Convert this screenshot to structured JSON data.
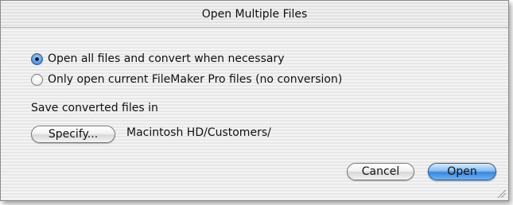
{
  "dialog": {
    "title": "Open Multiple Files"
  },
  "options": [
    {
      "label": "Open all files and convert when necessary",
      "selected": true
    },
    {
      "label": "Only open current FileMaker Pro files (no conversion)",
      "selected": false
    }
  ],
  "save": {
    "label": "Save converted files in",
    "specify_label": "Specify...",
    "path": "Macintosh HD/Customers/"
  },
  "buttons": {
    "cancel_label": "Cancel",
    "open_label": "Open"
  },
  "colors": {
    "default_button": "#3a86dd",
    "background_stripe_light": "#f4f4f4",
    "background_stripe_dark": "#e7e7e7"
  }
}
